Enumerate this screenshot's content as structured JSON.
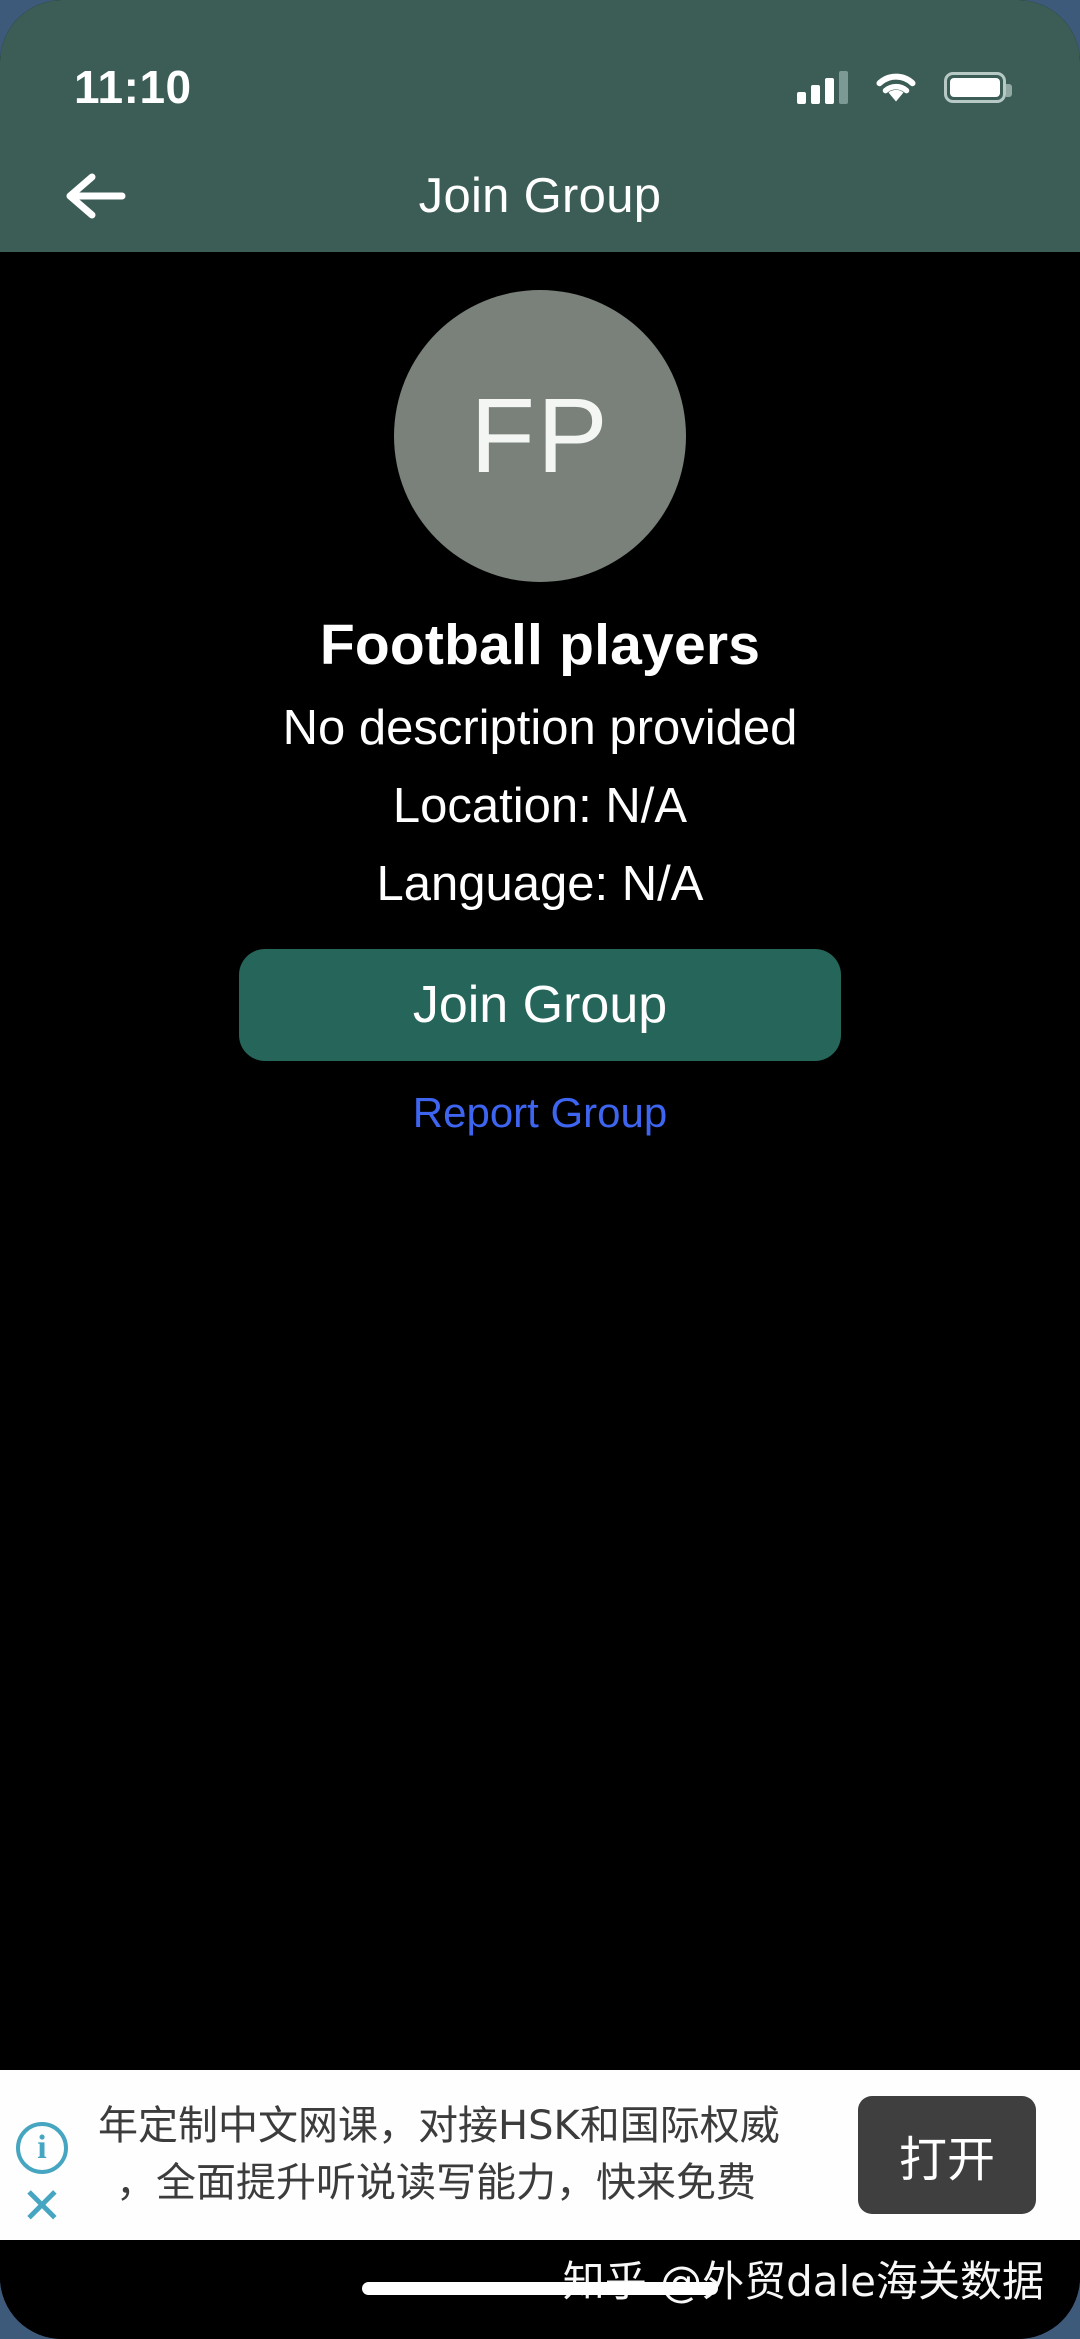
{
  "status_bar": {
    "time": "11:10",
    "signal_icon": "cellular-signal-icon",
    "wifi_icon": "wifi-icon",
    "battery_icon": "battery-icon"
  },
  "nav_bar": {
    "back_icon": "back-arrow-icon",
    "title": "Join Group"
  },
  "group": {
    "avatar_initials": "FP",
    "avatar_color": "#79817a",
    "name": "Football players",
    "description": "No description provided",
    "location": "Location: N/A",
    "language": "Language: N/A"
  },
  "actions": {
    "join_label": "Join Group",
    "join_color": "#25655a",
    "report_label": "Report Group",
    "report_color": "#3d65f0"
  },
  "ad": {
    "info_icon": "ad-choices-info-icon",
    "close_icon": "close-icon",
    "text_line1": "年定制中文网课，对接HSK和国际权威",
    "text_line2": "，全面提升听说读写能力，快来免费",
    "cta_label": "打开",
    "cta_color": "#3f3f3f",
    "accent_color": "#46a5c0"
  },
  "footer": {
    "home_indicator": "home-indicator",
    "watermark": "知乎 @外贸dale海关数据"
  },
  "theme": {
    "header_green": "#3b5d55",
    "background": "#000000",
    "bezel": "#3d5a7a"
  }
}
